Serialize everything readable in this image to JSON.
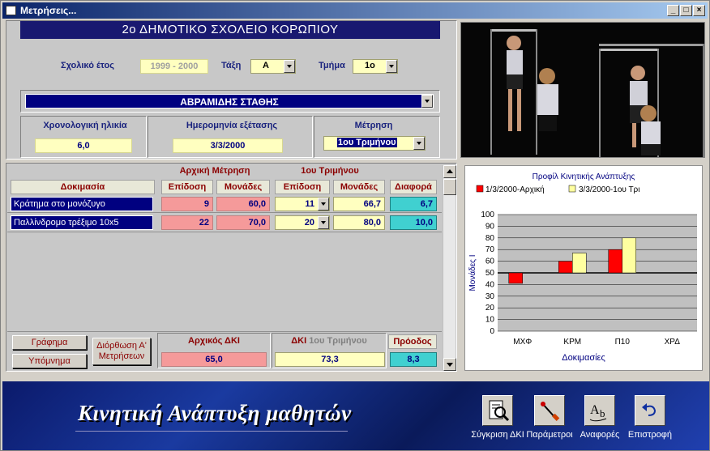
{
  "window": {
    "title": "Μετρήσεις..."
  },
  "school_title": "2ο ΔΗΜΟΤΙΚΟ ΣΧΟΛΕΙΟ ΚΟΡΩΠΙΟΥ",
  "filters": {
    "year_label": "Σχολικό έτος",
    "year_value": "1999 - 2000",
    "class_label": "Τάξη",
    "class_value": "Α",
    "section_label": "Τμήμα",
    "section_value": "1ο"
  },
  "student": {
    "name": "ΑΒΡΑΜΙΔΗΣ ΣΤΑΘΗΣ"
  },
  "info": {
    "age_label": "Χρονολογική ηλικία",
    "age_value": "6,0",
    "date_label": "Ημερομηνία εξέτασης",
    "date_value": "3/3/2000",
    "measurement_label": "Μέτρηση",
    "measurement_value": "1ου Τριμήνου"
  },
  "table": {
    "test_header": "Δοκιμασία",
    "initial_header": "Αρχική Μέτρηση",
    "current_header": "1ου Τριμήνου",
    "perf_header": "Επίδοση",
    "units_header": "Μονάδες",
    "diff_header": "Διαφορά",
    "rows": [
      {
        "test": "Κράτημα στο μονόζυγο",
        "init_perf": "9",
        "init_units": "60,0",
        "cur_perf": "11",
        "cur_units": "66,7",
        "diff": "6,7"
      },
      {
        "test": "Παλλίνδρομο τρέξιμο 10x5",
        "init_perf": "22",
        "init_units": "70,0",
        "cur_perf": "20",
        "cur_units": "80,0",
        "diff": "10,0"
      }
    ]
  },
  "summary": {
    "graph_btn": "Γράφημα",
    "legend_btn": "Υπόμνημα",
    "correct_btn_line1": "Διόρθωση Α'",
    "correct_btn_line2": "Μετρήσεων",
    "initial_dki_label": "Αρχικός ΔΚΙ",
    "initial_dki_value": "65,0",
    "dki_label_a": "ΔΚΙ",
    "dki_label_b": "1ου Τριμήνου",
    "dki_value": "73,3",
    "progress_label": "Πρόοδος",
    "progress_value": "8,3"
  },
  "chart_data": {
    "type": "bar",
    "title": "Προφίλ Κινητικής Ανάπτυξης",
    "xlabel": "Δοκιμασίες",
    "ylabel": "Μονάδες Ι",
    "ylim": [
      0,
      100
    ],
    "yticks": [
      "0",
      "10",
      "20",
      "30",
      "40",
      "50",
      "60",
      "70",
      "80",
      "90",
      "100"
    ],
    "baseline": 50,
    "categories": [
      "ΜΧΦ",
      "ΚΡΜ",
      "Π10",
      "ΧΡΔ"
    ],
    "series": [
      {
        "name": "1/3/2000-Αρχική",
        "color": "#ff0000",
        "values": [
          41,
          60,
          70,
          null
        ]
      },
      {
        "name": "3/3/2000-1ου Τρι",
        "color": "#ffffa0",
        "values": [
          null,
          67,
          80,
          null
        ]
      }
    ],
    "legend_position": "top",
    "grid": true
  },
  "banner": {
    "text": "Κινητική Ανάπτυξη μαθητών"
  },
  "tools": [
    {
      "label": "Σύγκριση ΔΚΙ",
      "icon": "magnifier-document-icon"
    },
    {
      "label": "Παράμετροι",
      "icon": "pen-tool-icon"
    },
    {
      "label": "Αναφορές",
      "icon": "abc-spelling-icon"
    },
    {
      "label": "Επιστροφή",
      "icon": "return-arrow-icon"
    }
  ]
}
